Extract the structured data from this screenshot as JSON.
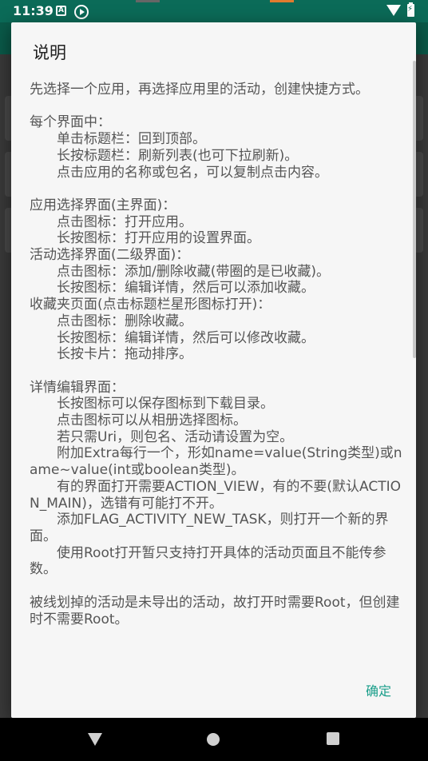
{
  "status_bar": {
    "time": "11:39",
    "icons": [
      "a-notification-icon",
      "play-icon",
      "wifi-icon",
      "battery-charging-icon"
    ]
  },
  "dialog": {
    "title": "说明",
    "body": "先选择一个应用，再选择应用里的活动，创建快捷方式。\n\n每个界面中：\n　　单击标题栏：回到顶部。\n　　长按标题栏：刷新列表(也可下拉刷新)。\n　　点击应用的名称或包名，可以复制点击内容。\n\n应用选择界面(主界面)：\n　　点击图标：打开应用。\n　　长按图标：打开应用的设置界面。\n活动选择界面(二级界面)：\n　　点击图标：添加/删除收藏(带圈的是已收藏)。\n　　长按图标：编辑详情，然后可以添加收藏。\n收藏夹页面(点击标题栏星形图标打开)：\n　　点击图标：删除收藏。\n　　长按图标：编辑详情，然后可以修改收藏。\n　　长按卡片：拖动排序。\n\n详情编辑界面：\n　　长按图标可以保存图标到下载目录。\n　　点击图标可以从相册选择图标。\n　　若只需Uri，则包名、活动请设置为空。\n　　附加Extra每行一个，形如name=value(String类型)或name~value(int或boolean类型)。\n　　有的界面打开需要ACTION_VIEW，有的不要(默认ACTION_MAIN)，选错有可能打不开。\n　　添加FLAG_ACTIVITY_NEW_TASK，则打开一个新的界面。\n　　使用Root打开暂只支持打开具体的活动页面且不能传参数。\n\n被线划掉的活动是未导出的活动，故打开时需要Root，但创建时不需要Root。",
    "confirm_label": "确定"
  },
  "colors": {
    "status_bar": "#0b6b58",
    "accent": "#1a9e8a",
    "dialog_bg": "#f6f6f6"
  }
}
